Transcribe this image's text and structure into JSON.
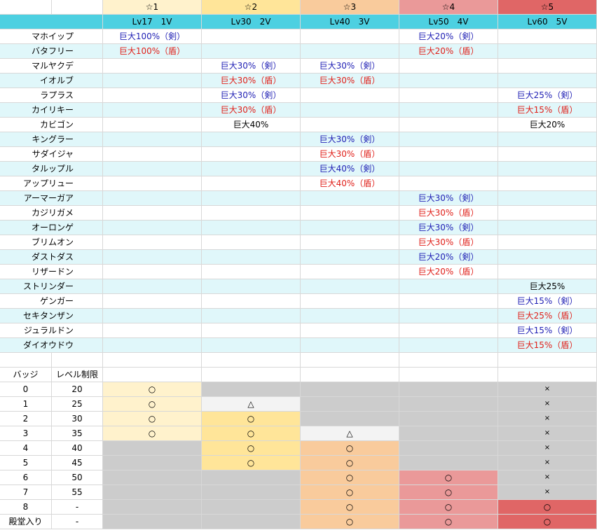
{
  "header": {
    "stars": [
      "☆1",
      "☆2",
      "☆3",
      "☆4",
      "☆5"
    ],
    "levels": [
      "Lv17　1V",
      "Lv30　2V",
      "Lv40　3V",
      "Lv50　4V",
      "Lv60　5V"
    ],
    "star_colors": [
      "#fff2cc",
      "#ffe599",
      "#f9cb9c",
      "#ea9999",
      "#e06666"
    ],
    "level_row_color": "#4dd0e1",
    "alt_row_color": "#e0f7fa"
  },
  "pokemon_rows": [
    {
      "name": "マホイップ",
      "cells": [
        {
          "t": "巨大100%（剣）",
          "c": "blue"
        },
        null,
        null,
        {
          "t": "巨大20%（剣）",
          "c": "blue"
        },
        null
      ]
    },
    {
      "name": "バタフリー",
      "cells": [
        {
          "t": "巨大100%（盾）",
          "c": "red"
        },
        null,
        null,
        {
          "t": "巨大20%（盾）",
          "c": "red"
        },
        null
      ]
    },
    {
      "name": "マルヤクデ",
      "cells": [
        null,
        {
          "t": "巨大30%（剣）",
          "c": "blue"
        },
        {
          "t": "巨大30%（剣）",
          "c": "blue"
        },
        null,
        null
      ]
    },
    {
      "name": "イオルブ",
      "cells": [
        null,
        {
          "t": "巨大30%（盾）",
          "c": "red"
        },
        {
          "t": "巨大30%（盾）",
          "c": "red"
        },
        null,
        null
      ]
    },
    {
      "name": "ラプラス",
      "cells": [
        null,
        {
          "t": "巨大30%（剣）",
          "c": "blue"
        },
        null,
        null,
        {
          "t": "巨大25%（剣）",
          "c": "blue"
        }
      ]
    },
    {
      "name": "カイリキー",
      "cells": [
        null,
        {
          "t": "巨大30%（盾）",
          "c": "red"
        },
        null,
        null,
        {
          "t": "巨大15%（盾）",
          "c": "red"
        }
      ]
    },
    {
      "name": "カビゴン",
      "cells": [
        null,
        {
          "t": "巨大40%",
          "c": "blk"
        },
        null,
        null,
        {
          "t": "巨大20%",
          "c": "blk"
        }
      ]
    },
    {
      "name": "キングラー",
      "cells": [
        null,
        null,
        {
          "t": "巨大30%（剣）",
          "c": "blue"
        },
        null,
        null
      ]
    },
    {
      "name": "サダイジャ",
      "cells": [
        null,
        null,
        {
          "t": "巨大30%（盾）",
          "c": "red"
        },
        null,
        null
      ]
    },
    {
      "name": "タルップル",
      "cells": [
        null,
        null,
        {
          "t": "巨大40%（剣）",
          "c": "blue"
        },
        null,
        null
      ]
    },
    {
      "name": "アップリュー",
      "cells": [
        null,
        null,
        {
          "t": "巨大40%（盾）",
          "c": "red"
        },
        null,
        null
      ]
    },
    {
      "name": "アーマーガア",
      "cells": [
        null,
        null,
        null,
        {
          "t": "巨大30%（剣）",
          "c": "blue"
        },
        null
      ]
    },
    {
      "name": "カジリガメ",
      "cells": [
        null,
        null,
        null,
        {
          "t": "巨大30%（盾）",
          "c": "red"
        },
        null
      ]
    },
    {
      "name": "オーロンゲ",
      "cells": [
        null,
        null,
        null,
        {
          "t": "巨大30%（剣）",
          "c": "blue"
        },
        null
      ]
    },
    {
      "name": "ブリムオン",
      "cells": [
        null,
        null,
        null,
        {
          "t": "巨大30%（盾）",
          "c": "red"
        },
        null
      ]
    },
    {
      "name": "ダストダス",
      "cells": [
        null,
        null,
        null,
        {
          "t": "巨大20%（剣）",
          "c": "blue"
        },
        null
      ]
    },
    {
      "name": "リザードン",
      "cells": [
        null,
        null,
        null,
        {
          "t": "巨大20%（盾）",
          "c": "red"
        },
        null
      ]
    },
    {
      "name": "ストリンダー",
      "cells": [
        null,
        null,
        null,
        null,
        {
          "t": "巨大25%",
          "c": "blk"
        }
      ]
    },
    {
      "name": "ゲンガー",
      "cells": [
        null,
        null,
        null,
        null,
        {
          "t": "巨大15%（剣）",
          "c": "blue"
        }
      ]
    },
    {
      "name": "セキタンザン",
      "cells": [
        null,
        null,
        null,
        null,
        {
          "t": "巨大25%（盾）",
          "c": "red"
        }
      ]
    },
    {
      "name": "ジュラルドン",
      "cells": [
        null,
        null,
        null,
        null,
        {
          "t": "巨大15%（剣）",
          "c": "blue"
        }
      ]
    },
    {
      "name": "ダイオウドウ",
      "cells": [
        null,
        null,
        null,
        null,
        {
          "t": "巨大15%（盾）",
          "c": "red"
        }
      ]
    }
  ],
  "badge_table": {
    "headers": [
      "バッジ",
      "レベル制限"
    ],
    "colors": {
      "gray": "#cccccc",
      "light": "#f3f3f3"
    },
    "rows": [
      {
        "badge": "0",
        "limit": "20",
        "cells": [
          {
            "s": "○",
            "bg": "s1"
          },
          {
            "s": "",
            "bg": "gray"
          },
          {
            "s": "",
            "bg": "gray"
          },
          {
            "s": "",
            "bg": "gray"
          },
          {
            "s": "×",
            "bg": "gray"
          }
        ]
      },
      {
        "badge": "1",
        "limit": "25",
        "cells": [
          {
            "s": "○",
            "bg": "s1"
          },
          {
            "s": "△",
            "bg": "light"
          },
          {
            "s": "",
            "bg": "gray"
          },
          {
            "s": "",
            "bg": "gray"
          },
          {
            "s": "×",
            "bg": "gray"
          }
        ]
      },
      {
        "badge": "2",
        "limit": "30",
        "cells": [
          {
            "s": "○",
            "bg": "s1"
          },
          {
            "s": "○",
            "bg": "s2"
          },
          {
            "s": "",
            "bg": "gray"
          },
          {
            "s": "",
            "bg": "gray"
          },
          {
            "s": "×",
            "bg": "gray"
          }
        ]
      },
      {
        "badge": "3",
        "limit": "35",
        "cells": [
          {
            "s": "○",
            "bg": "s1"
          },
          {
            "s": "○",
            "bg": "s2"
          },
          {
            "s": "△",
            "bg": "light"
          },
          {
            "s": "",
            "bg": "gray"
          },
          {
            "s": "×",
            "bg": "gray"
          }
        ]
      },
      {
        "badge": "4",
        "limit": "40",
        "cells": [
          {
            "s": "",
            "bg": "gray"
          },
          {
            "s": "○",
            "bg": "s2"
          },
          {
            "s": "○",
            "bg": "s3"
          },
          {
            "s": "",
            "bg": "gray"
          },
          {
            "s": "×",
            "bg": "gray"
          }
        ]
      },
      {
        "badge": "5",
        "limit": "45",
        "cells": [
          {
            "s": "",
            "bg": "gray"
          },
          {
            "s": "○",
            "bg": "s2"
          },
          {
            "s": "○",
            "bg": "s3"
          },
          {
            "s": "",
            "bg": "gray"
          },
          {
            "s": "×",
            "bg": "gray"
          }
        ]
      },
      {
        "badge": "6",
        "limit": "50",
        "cells": [
          {
            "s": "",
            "bg": "gray"
          },
          {
            "s": "",
            "bg": "gray"
          },
          {
            "s": "○",
            "bg": "s3"
          },
          {
            "s": "○",
            "bg": "s4"
          },
          {
            "s": "×",
            "bg": "gray"
          }
        ]
      },
      {
        "badge": "7",
        "limit": "55",
        "cells": [
          {
            "s": "",
            "bg": "gray"
          },
          {
            "s": "",
            "bg": "gray"
          },
          {
            "s": "○",
            "bg": "s3"
          },
          {
            "s": "○",
            "bg": "s4"
          },
          {
            "s": "×",
            "bg": "gray"
          }
        ]
      },
      {
        "badge": "8",
        "limit": "-",
        "cells": [
          {
            "s": "",
            "bg": "gray"
          },
          {
            "s": "",
            "bg": "gray"
          },
          {
            "s": "○",
            "bg": "s3"
          },
          {
            "s": "○",
            "bg": "s4"
          },
          {
            "s": "○",
            "bg": "s5"
          }
        ]
      },
      {
        "badge": "殿堂入り",
        "limit": "-",
        "cells": [
          {
            "s": "",
            "bg": "gray"
          },
          {
            "s": "",
            "bg": "gray"
          },
          {
            "s": "○",
            "bg": "s3"
          },
          {
            "s": "○",
            "bg": "s4"
          },
          {
            "s": "○",
            "bg": "s5"
          }
        ]
      }
    ]
  }
}
